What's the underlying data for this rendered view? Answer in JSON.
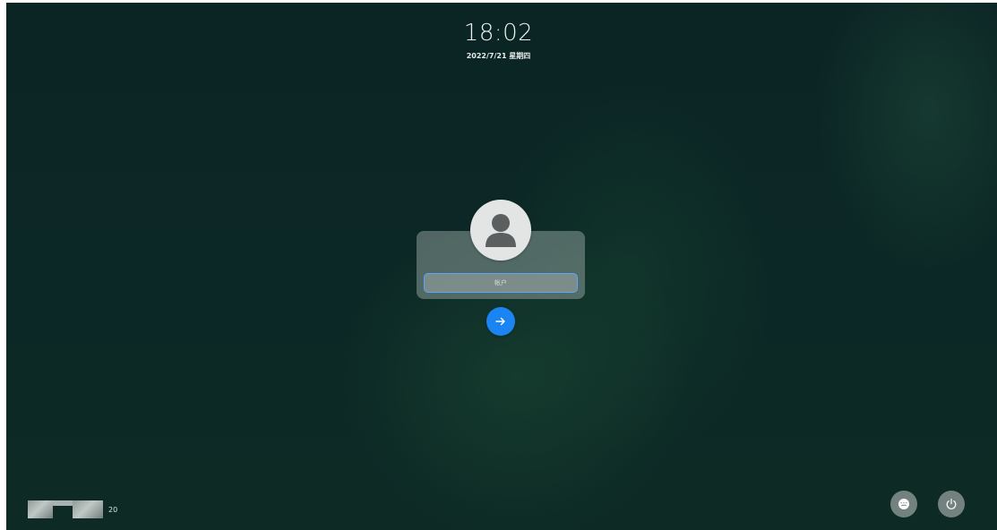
{
  "lockscreen": {
    "time": "18:02",
    "date": "2022/7/21 星期四"
  },
  "login": {
    "avatar_icon": "user-avatar-icon",
    "account_placeholder": "帐户",
    "account_value": "",
    "submit_icon": "arrow-right-icon",
    "accent_color": "#1a84f2"
  },
  "bottom_left": {
    "keyboard_layout_count": "20"
  },
  "bottom_right": {
    "keyboard_icon": "keyboard-icon",
    "power_icon": "power-icon"
  }
}
